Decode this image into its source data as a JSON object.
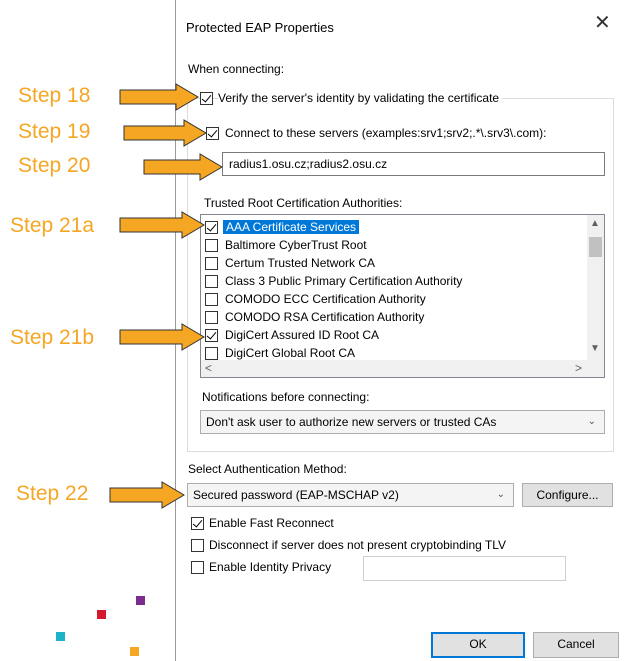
{
  "dialog": {
    "title": "Protected EAP Properties",
    "close_label": "✕",
    "when_connecting_label": "When connecting:",
    "verify_identity": {
      "label": "Verify the server's identity by validating the certificate",
      "checked": true
    },
    "connect_servers": {
      "label": "Connect to these servers (examples:srv1;srv2;.*\\.srv3\\.com):",
      "checked": true
    },
    "servers_value": "radius1.osu.cz;radius2.osu.cz",
    "trusted_root_label": "Trusted Root Certification Authorities:",
    "cas": [
      {
        "label": "AAA Certificate Services",
        "checked": true,
        "selected": true
      },
      {
        "label": "Baltimore CyberTrust Root",
        "checked": false,
        "selected": false
      },
      {
        "label": "Certum Trusted Network CA",
        "checked": false,
        "selected": false
      },
      {
        "label": "Class 3 Public Primary Certification Authority",
        "checked": false,
        "selected": false
      },
      {
        "label": "COMODO ECC Certification Authority",
        "checked": false,
        "selected": false
      },
      {
        "label": "COMODO RSA Certification Authority",
        "checked": false,
        "selected": false
      },
      {
        "label": "DigiCert Assured ID Root CA",
        "checked": true,
        "selected": false
      },
      {
        "label": "DigiCert Global Root CA",
        "checked": false,
        "selected": false
      }
    ],
    "notifications_label": "Notifications before connecting:",
    "notifications_value": "Don't ask user to authorize new servers or trusted CAs",
    "auth_method_label": "Select Authentication Method:",
    "auth_method_value": "Secured password (EAP-MSCHAP v2)",
    "configure_label": "Configure...",
    "fast_reconnect": {
      "label": "Enable Fast Reconnect",
      "checked": true
    },
    "cryptobinding": {
      "label": "Disconnect if server does not present cryptobinding TLV",
      "checked": false
    },
    "identity_privacy": {
      "label": "Enable Identity Privacy",
      "checked": false
    },
    "ok_label": "OK",
    "cancel_label": "Cancel"
  },
  "steps": {
    "s18": "Step 18",
    "s19": "Step 19",
    "s20": "Step 20",
    "s21a": "Step 21a",
    "s21b": "Step 21b",
    "s22": "Step 22"
  },
  "colors": {
    "accent": "#f5a623",
    "selection": "#0078d7"
  },
  "icons": [
    "close-icon",
    "chevron-down-icon",
    "scroll-up-icon",
    "scroll-down-icon",
    "scroll-left-icon",
    "scroll-right-icon",
    "arrow-right-icon"
  ]
}
